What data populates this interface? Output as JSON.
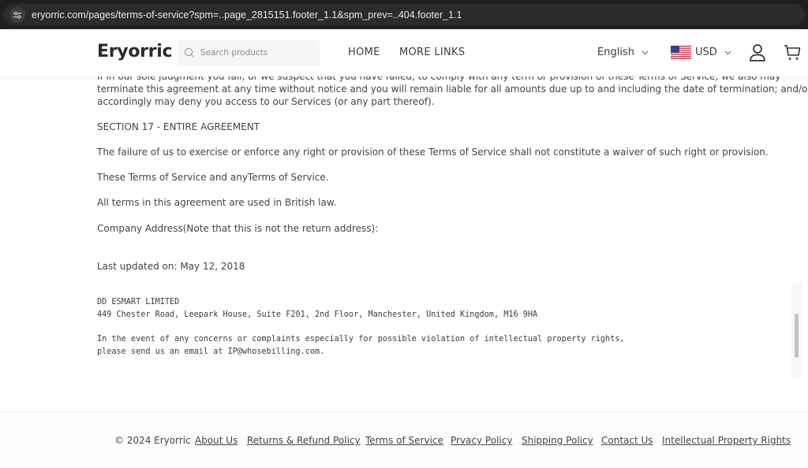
{
  "browser": {
    "url": "eryorric.com/pages/terms-of-service?spm=..page_2815151.footer_1.1&spm_prev=..404.footer_1.1",
    "site_info_icon": "tune-icon"
  },
  "header": {
    "logo": "Eryorric",
    "search_placeholder": "Search products",
    "nav": [
      {
        "label": "HOME"
      },
      {
        "label": "MORE LINKS"
      }
    ],
    "language": "English",
    "currency": "USD",
    "currency_flag": "us-flag-icon",
    "icons": [
      "user-icon",
      "cart-icon"
    ]
  },
  "content": {
    "para_cut": "If in our sole judgment you fail, or we suspect that you have failed, to comply with any term or provision of these Terms of Service, we also may",
    "para_line2": "terminate this agreement at any time without notice and you will remain liable for all amounts due up to and including the date of termination; and/or",
    "para_line3": "accordingly may deny you access to our Services (or any part thereof).",
    "section_title": "SECTION 17 - ENTIRE AGREEMENT",
    "para_waiver": "The failure of us to exercise or enforce any right or provision of these Terms of Service shall not constitute a waiver of such right or provision.",
    "para_terms": "These Terms of Service and anyTerms of Service.",
    "para_law": "All terms in this agreement are used in British law.",
    "para_address_note": "Company Address(Note that this is not the return address):",
    "last_updated": "Last updated on: May 12, 2018",
    "company_name": "DD ESMART LIMITED",
    "company_address": "449 Chester Road, Leepark House, Suite F201, 2nd Floor, Manchester, United Kingdom, M16 9HA",
    "ip_line1": "In the event of any concerns or complaints especially for possible violation of intellectual property rights,",
    "ip_line2": "please send us an email at IP@whosebilling.com."
  },
  "footer": {
    "copyright": "© 2024 Eryorric",
    "links": [
      {
        "label": "About Us"
      },
      {
        "label": "Returns & Refund Policy"
      },
      {
        "label": "Terms of Service"
      },
      {
        "label": "Prvacy Policy"
      },
      {
        "label": "Shipping Policy"
      },
      {
        "label": "Contact Us"
      },
      {
        "label": "Intellectual Property Rights"
      }
    ]
  },
  "colors": {
    "text": "#444444",
    "browser_bar": "#1f1f1f",
    "background": "#ffffff"
  }
}
